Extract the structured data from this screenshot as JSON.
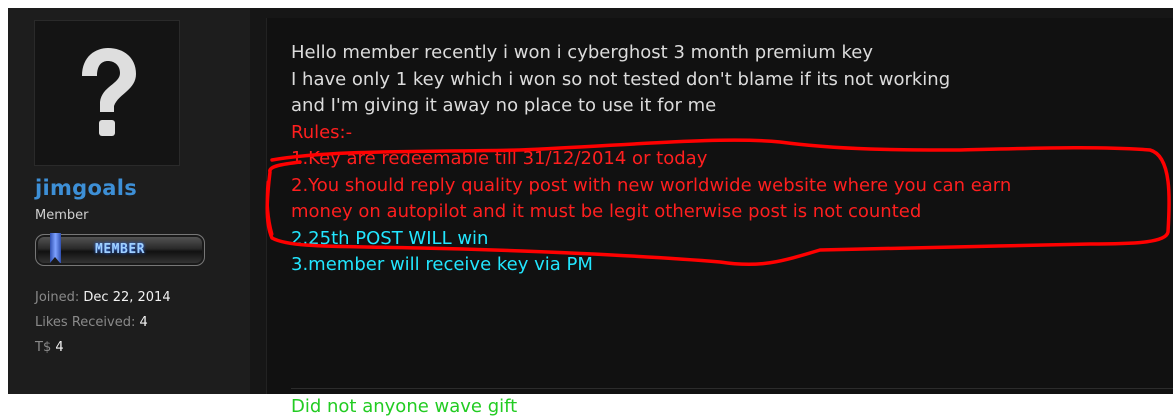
{
  "user": {
    "username": "jimgoals",
    "title": "Member",
    "rank_badge": "MEMBER",
    "stats": [
      {
        "label": "Joined:",
        "value": "Dec 22, 2014"
      },
      {
        "label": "Likes Received:",
        "value": "4"
      },
      {
        "label": "T$",
        "value": "4"
      }
    ],
    "avatar_icon": "question-mark-icon"
  },
  "message": {
    "lines": [
      {
        "text": "Hello member recently i won i cyberghost 3 month premium key",
        "color": "white"
      },
      {
        "text": "I have only 1 key which i won so not tested don't blame if its not working",
        "color": "white"
      },
      {
        "text": "and I'm giving it away no place to use it for me",
        "color": "white"
      },
      {
        "text": "Rules:-",
        "color": "red"
      },
      {
        "text": "1.Key are redeemable till 31/12/2014 or today",
        "color": "red"
      },
      {
        "text": "2.You should reply quality post with new worldwide website where you can earn",
        "color": "red"
      },
      {
        "text": "money on autopilot and it must be legit otherwise post is not counted",
        "color": "red"
      },
      {
        "text": "2.25th POST WILL win",
        "color": "cyan"
      },
      {
        "text": "3.member will receive key via PM",
        "color": "cyan"
      }
    ]
  },
  "signature": {
    "text": "Did not anyone wave gift"
  },
  "colors": {
    "username": "#3d8fd6",
    "text_white": "#dcdcdc",
    "text_red": "#ff1f1f",
    "text_cyan": "#22e6ff",
    "annotation_red": "#ff0000"
  }
}
